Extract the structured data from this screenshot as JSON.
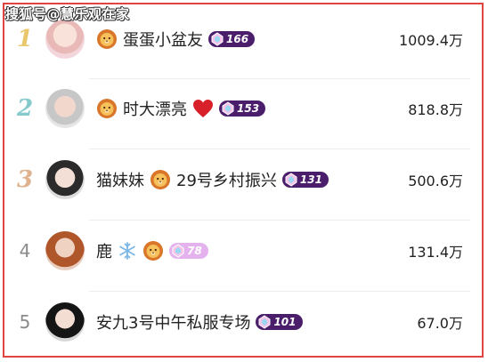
{
  "watermark": "搜狐号@慧乐观在家",
  "colors": {
    "rank1": "#e9c76b",
    "rank2": "#86c9cc",
    "rank3": "#dfb38f",
    "badge_dark": "#4a1e6b",
    "badge_light": "#e4b3ee",
    "border": "#e0463f"
  },
  "rows": [
    {
      "rank": "1",
      "name": "蛋蛋小盆友",
      "level": "166",
      "value": "1009.4万"
    },
    {
      "rank": "2",
      "name": "时大漂亮",
      "level": "153",
      "value": "818.8万"
    },
    {
      "rank": "3",
      "name": "猫妹妹",
      "name_suffix": "29号乡村振兴",
      "level": "131",
      "value": "500.6万"
    },
    {
      "rank": "4",
      "name": "鹿",
      "level": "78",
      "value": "131.4万"
    },
    {
      "rank": "5",
      "name": "安九3号中午私服专场",
      "level": "101",
      "value": "67.0万"
    }
  ]
}
